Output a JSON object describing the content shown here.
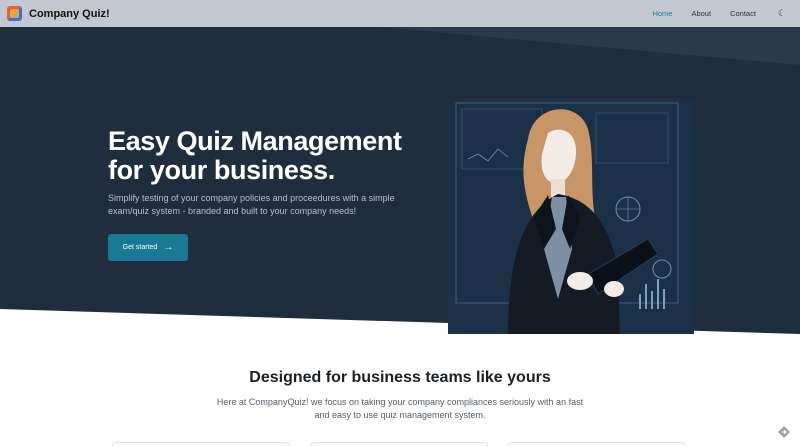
{
  "header": {
    "brand": "Company Quiz!",
    "nav": [
      {
        "label": "Home",
        "active": true
      },
      {
        "label": "About",
        "active": false
      },
      {
        "label": "Contact",
        "active": false
      }
    ],
    "theme_toggle_icon": "moon-icon"
  },
  "hero": {
    "title": "Easy Quiz Management for your business.",
    "subtitle": "Simplify testing of your company policies and proceedures with a simple exam/quiz system - branded and built to your company needs!",
    "cta_label": "Get started",
    "cta_icon": "arrow-right-icon",
    "illustration_icon": "businesswoman-tablet-illustration"
  },
  "features": {
    "title": "Designed for business teams like yours",
    "text": "Here at CompanyQuiz! we focus on taking your company compliances seriously with an fast and easy to use quiz management system."
  },
  "colors": {
    "header_bg": "#c3c7d0",
    "hero_bg": "#1f2d3e",
    "accent": "#1a7a93",
    "active_nav": "#1f7aa0"
  }
}
